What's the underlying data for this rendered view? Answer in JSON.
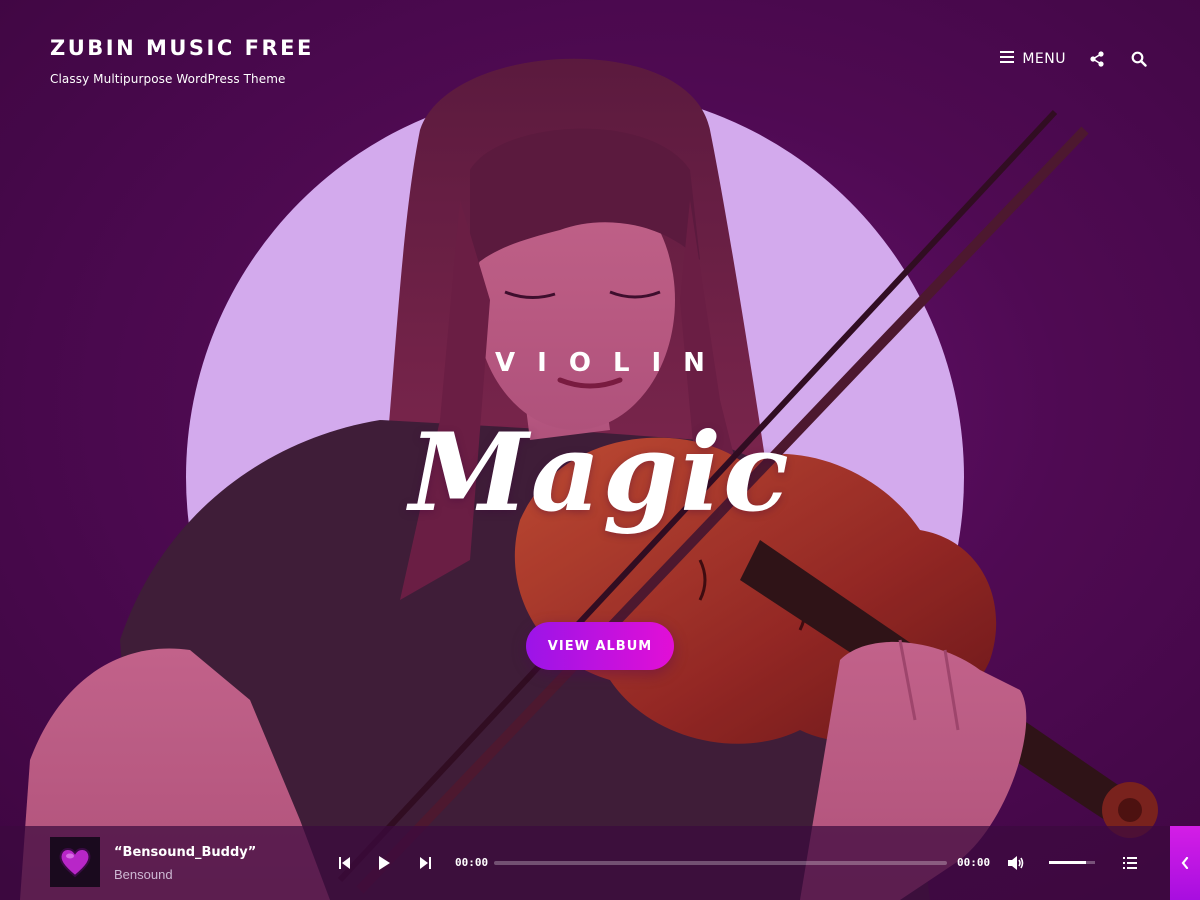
{
  "header": {
    "site_title": "ZUBIN MUSIC FREE",
    "site_tagline": "Classy Multipurpose WordPress Theme"
  },
  "nav": {
    "menu_label": "MENU",
    "icons": [
      "hamburger-icon",
      "share-icon",
      "search-icon"
    ]
  },
  "hero": {
    "kicker": "VIOLIN",
    "headline": "Magic",
    "cta_label": "VIEW ALBUM",
    "circle_color": "#dcb8f8",
    "background_color": "#4a0a4e"
  },
  "player": {
    "track_title": "“Bensound_Buddy”",
    "track_artist": "Bensound",
    "current_time": "00:00",
    "duration": "00:00",
    "progress": 0,
    "volume": 0.8,
    "icons": [
      "album-cover-heart",
      "previous-icon",
      "play-icon",
      "next-icon",
      "volume-icon",
      "playlist-icon"
    ]
  },
  "sidebar_toggle": {
    "icon": "chevron-left-icon",
    "color": "#d41ee6"
  }
}
